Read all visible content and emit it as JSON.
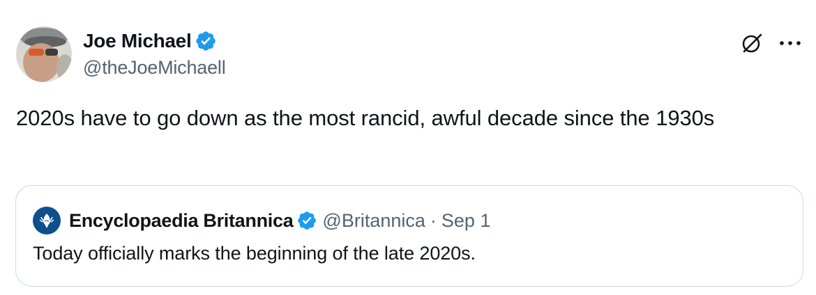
{
  "tweet": {
    "author": {
      "display_name": "Joe Michael",
      "handle": "@theJoeMichaell",
      "verified": true
    },
    "text": "2020s have to go down as the most rancid, awful decade since the 1930s",
    "actions": {
      "grok_icon": "grok-icon",
      "more_icon": "more-horizontal-icon"
    }
  },
  "quoted_tweet": {
    "author": {
      "display_name": "Encyclopaedia Britannica",
      "handle": "@Britannica",
      "verified": true
    },
    "separator": "·",
    "date": "Sep 1",
    "text": "Today officially marks the beginning of the late 2020s."
  },
  "colors": {
    "text_primary": "#0f1419",
    "text_secondary": "#536471",
    "verified_blue": "#1d9bf0",
    "border": "#cfd9de",
    "britannica_blue": "#0e4f8c"
  }
}
